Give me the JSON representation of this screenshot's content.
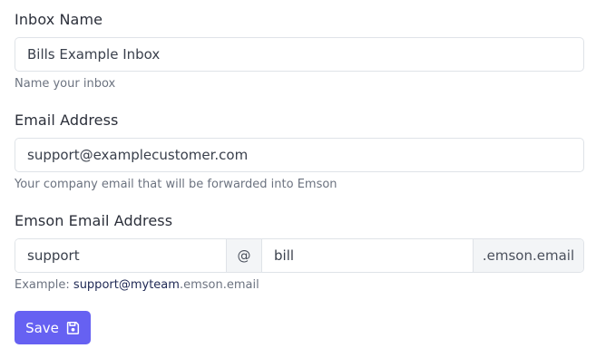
{
  "inbox_name": {
    "label": "Inbox Name",
    "value": "Bills Example Inbox",
    "help": "Name your inbox"
  },
  "email_address": {
    "label": "Email Address",
    "value": "support@examplecustomer.com",
    "help": "Your company email that will be forwarded into Emson"
  },
  "emson_email": {
    "label": "Emson Email Address",
    "local_part": "support",
    "at_symbol": "@",
    "subdomain": "bill",
    "domain_suffix": ".emson.email",
    "example_prefix": "Example: ",
    "example_local": "support",
    "example_at": "@",
    "example_team": "myteam",
    "example_suffix": ".emson.email"
  },
  "save_button": {
    "label": "Save",
    "icon": "floppy-disk-icon",
    "color": "#6661f2"
  }
}
